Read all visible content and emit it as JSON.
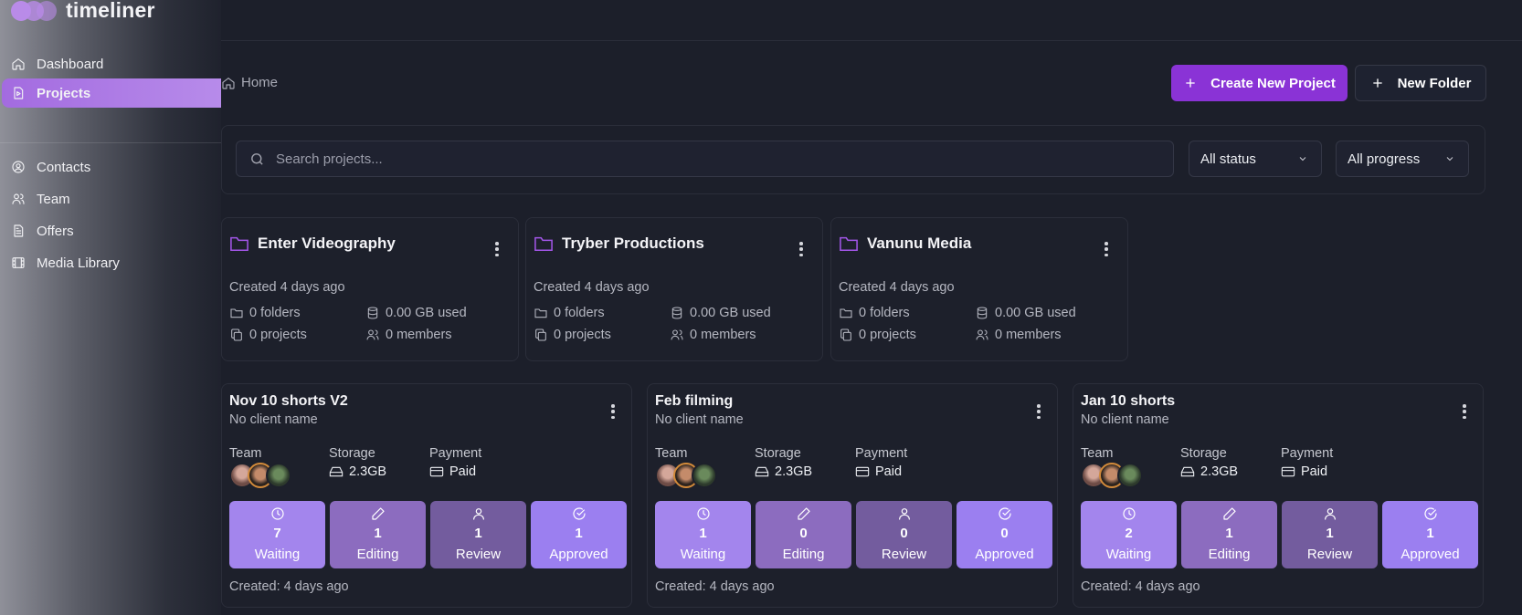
{
  "app": {
    "name": "timeliner"
  },
  "sidebar": {
    "items": [
      {
        "label": "Dashboard",
        "icon": "home-icon",
        "active": false
      },
      {
        "label": "Projects",
        "icon": "file-video-icon",
        "active": true
      },
      {
        "label": "Contacts",
        "icon": "user-circle-icon",
        "active": false
      },
      {
        "label": "Team",
        "icon": "users-icon",
        "active": false
      },
      {
        "label": "Offers",
        "icon": "document-icon",
        "active": false
      },
      {
        "label": "Media Library",
        "icon": "film-icon",
        "active": false
      }
    ]
  },
  "breadcrumb": {
    "home": "Home"
  },
  "actions": {
    "create_project": "Create New Project",
    "new_folder": "New Folder"
  },
  "filters": {
    "search_placeholder": "Search projects...",
    "status": "All status",
    "progress": "All progress"
  },
  "folders": [
    {
      "name": "Enter Videography",
      "created": "Created 4 days ago",
      "folders": "0 folders",
      "storage": "0.00 GB used",
      "projects": "0 projects",
      "members": "0 members"
    },
    {
      "name": "Tryber Productions",
      "created": "Created 4 days ago",
      "folders": "0 folders",
      "storage": "0.00 GB used",
      "projects": "0 projects",
      "members": "0 members"
    },
    {
      "name": "Vanunu Media",
      "created": "Created 4 days ago",
      "folders": "0 folders",
      "storage": "0.00 GB used",
      "projects": "0 projects",
      "members": "0 members"
    }
  ],
  "project_labels": {
    "team": "Team",
    "storage": "Storage",
    "payment": "Payment",
    "waiting": "Waiting",
    "editing": "Editing",
    "review": "Review",
    "approved": "Approved"
  },
  "projects": [
    {
      "title": "Nov 10 shorts V2",
      "client": "No client name",
      "storage": "2.3GB",
      "payment": "Paid",
      "waiting": "7",
      "editing": "1",
      "review": "1",
      "approved": "1",
      "created": "Created: 4 days ago"
    },
    {
      "title": "Feb filming",
      "client": "No client name",
      "storage": "2.3GB",
      "payment": "Paid",
      "waiting": "1",
      "editing": "0",
      "review": "0",
      "approved": "0",
      "created": "Created: 4 days ago"
    },
    {
      "title": "Jan 10 shorts",
      "client": "No client name",
      "storage": "2.3GB",
      "payment": "Paid",
      "waiting": "2",
      "editing": "1",
      "review": "1",
      "approved": "1",
      "created": "Created: 4 days ago"
    }
  ],
  "colors": {
    "accent": "#8a33d6",
    "active_nav": "#a36be0",
    "folder_icon": "#a256e8",
    "background": "#1c1f2a"
  }
}
